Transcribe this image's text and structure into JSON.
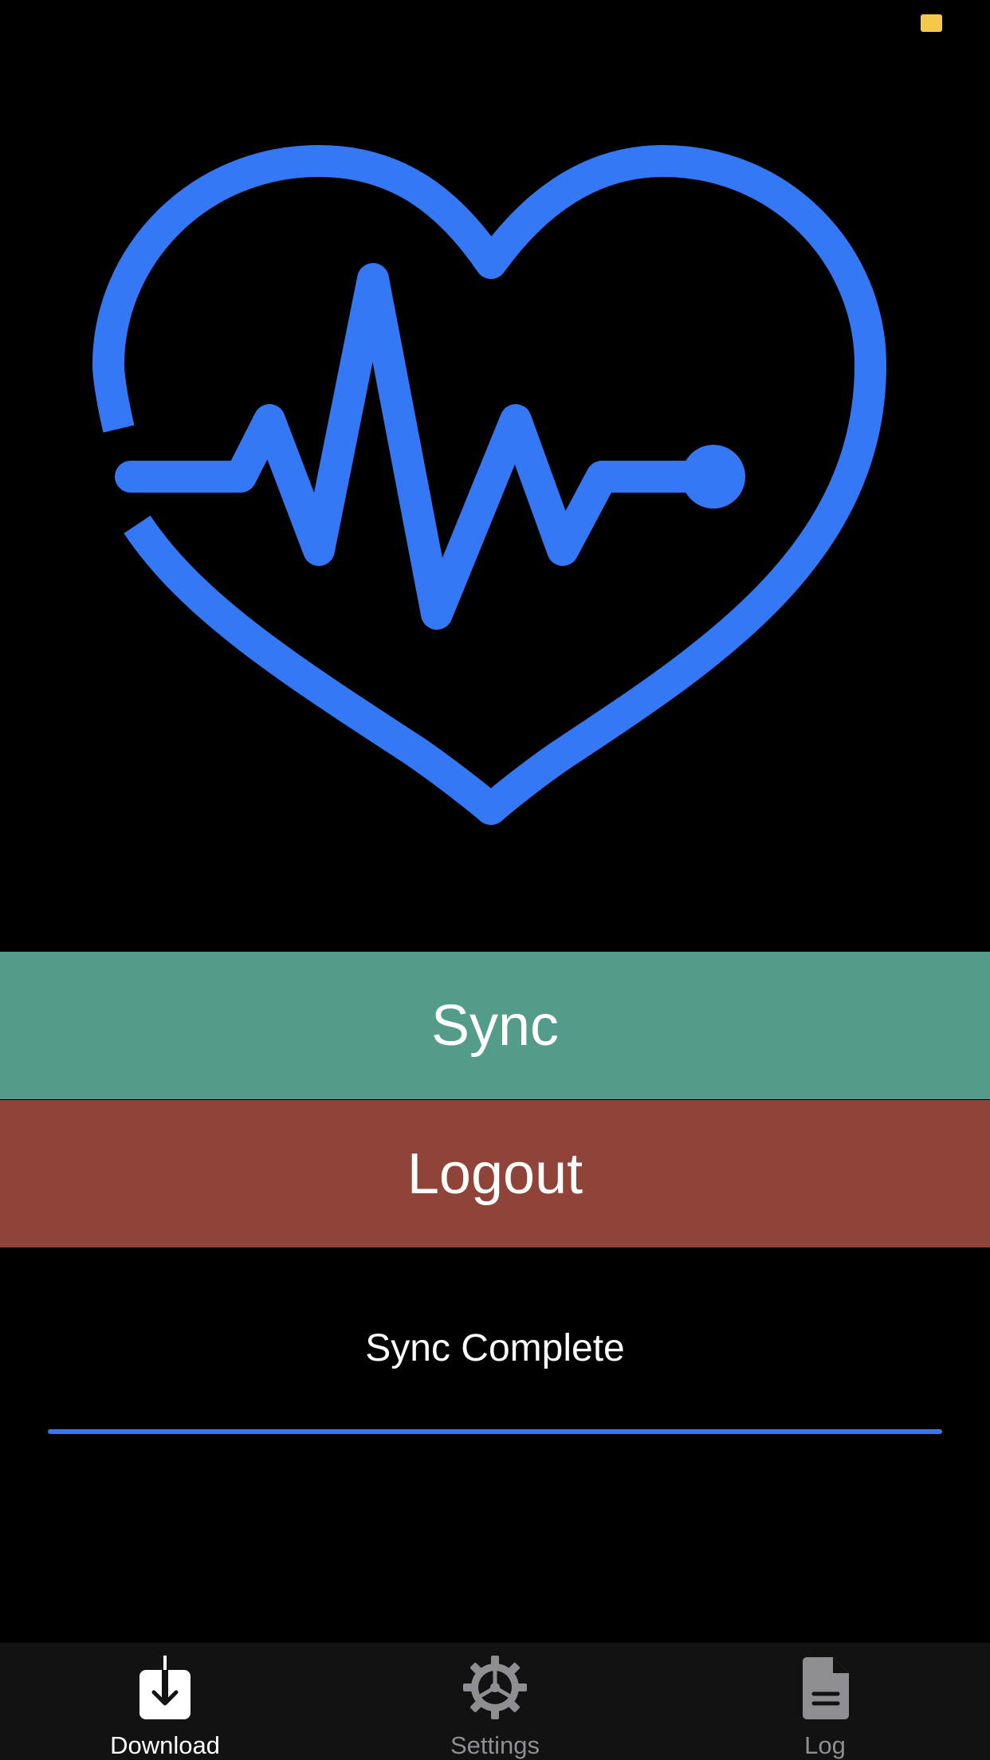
{
  "status_bar": {
    "battery_color": "#F4C94A"
  },
  "hero": {
    "icon": "heart-pulse-icon",
    "color": "#3478F6"
  },
  "actions": {
    "sync_label": "Sync",
    "sync_color": "#529C89",
    "logout_label": "Logout",
    "logout_color": "#904338"
  },
  "status": {
    "text": "Sync Complete",
    "progress": 1.0,
    "progress_color": "#3478F6"
  },
  "tabs": [
    {
      "label": "Download",
      "icon": "download-icon",
      "selected": true
    },
    {
      "label": "Settings",
      "icon": "gear-icon",
      "selected": false
    },
    {
      "label": "Log",
      "icon": "document-icon",
      "selected": false
    }
  ],
  "tab_colors": {
    "selected": "#FFFFFF",
    "unselected": "#8E8E93"
  }
}
